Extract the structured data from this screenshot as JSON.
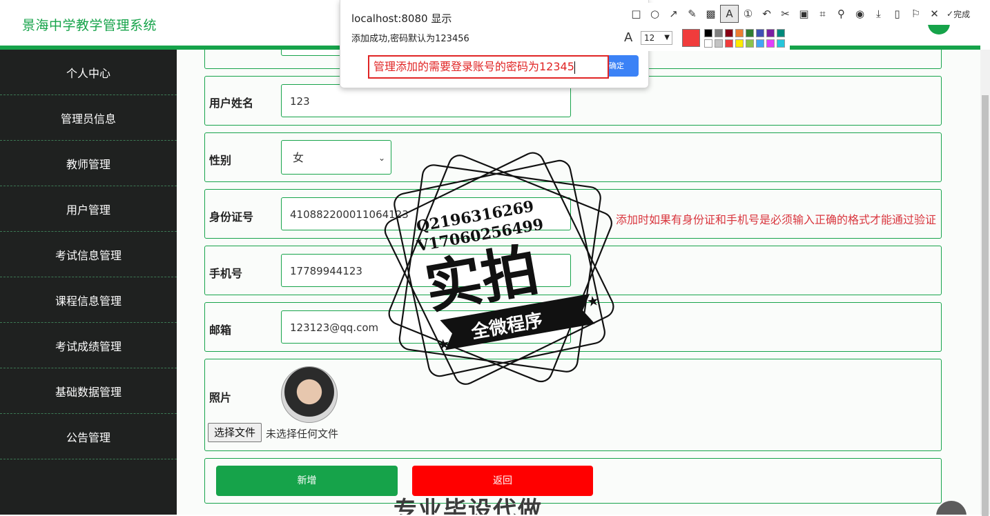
{
  "header": {
    "brand": "景海中学教学管理系统"
  },
  "sidebar": {
    "items": [
      {
        "label": "个人中心"
      },
      {
        "label": "管理员信息"
      },
      {
        "label": "教师管理"
      },
      {
        "label": "用户管理"
      },
      {
        "label": "考试信息管理"
      },
      {
        "label": "课程信息管理"
      },
      {
        "label": "考试成绩管理"
      },
      {
        "label": "基础数据管理"
      },
      {
        "label": "公告管理"
      }
    ]
  },
  "form": {
    "name_label": "用户姓名",
    "name_value": "123",
    "gender_label": "性别",
    "gender_value": "女",
    "id_label": "身份证号",
    "id_value": "410882200011064123",
    "phone_label": "手机号",
    "phone_value": "17789944123",
    "email_label": "邮箱",
    "email_value": "123123@qq.com",
    "photo_label": "照片",
    "file_button": "选择文件",
    "file_status": "未选择任何文件",
    "hint": "添加时如果有身份证和手机号是必须输入正确的格式才能通过验证",
    "add_button": "新增",
    "back_button": "返回"
  },
  "dialog": {
    "origin": "localhost:8080 显示",
    "message": "添加成功,密码默认为123456",
    "ok": "确定"
  },
  "annotation": {
    "text": "管理添加的需要登录账号的密码为12345"
  },
  "screenshot_toolbar": {
    "font_size": "12",
    "done_label": "完成",
    "selected_color": "#f03c3c"
  },
  "watermark": {
    "line1": "Q2196316269",
    "line2": "V17060256499",
    "big": "实拍",
    "banner": "全微程序",
    "bottom": "专业毕设代做"
  }
}
